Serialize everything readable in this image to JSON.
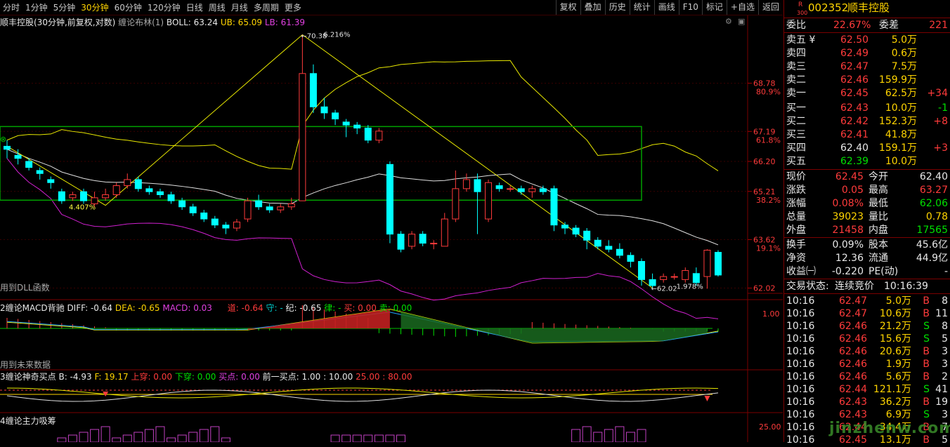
{
  "toolbar": {
    "timeframes": [
      "分时",
      "1分钟",
      "5分钟",
      "30分钟",
      "60分钟",
      "120分钟",
      "日线",
      "周线",
      "月线",
      "多周期",
      "更多"
    ],
    "active": "30分钟",
    "buttons": [
      "复权",
      "叠加",
      "历史",
      "统计",
      "画线",
      "F10",
      "标记",
      "+自选",
      "返回"
    ]
  },
  "main_panel": {
    "title": "顺丰控股(30分钟,前复权,对数)",
    "indicator": "缠论布林(1)",
    "boll_label": "BOLL: 63.24",
    "ub_label": "UB: 65.09",
    "lb_label": "LB: 61.39",
    "dll_text": "用到DLL函数",
    "high_mark": "70.38",
    "high_pct": "6.216%",
    "low_pct_left": "4.407%",
    "low_mark": "62.02",
    "low_pct_right": "1.978%",
    "circle_marker": "⊗"
  },
  "y_axis": [
    {
      "price": "68.78",
      "pct": "80.9%"
    },
    {
      "price": "67.19",
      "pct": "61.8%"
    },
    {
      "price": "66.20",
      "pct": ""
    },
    {
      "price": "65.21",
      "pct": "38.2%"
    },
    {
      "price": "63.62",
      "pct": "19.1%"
    },
    {
      "price": "62.02",
      "pct": ""
    }
  ],
  "macd_panel": {
    "name": "2缠论MACD背驰",
    "diff": "DIFF: -0.64",
    "dea": "DEA: -0.65",
    "macd": "MACD: 0.03",
    "dao": "道: -0.64",
    "shou": "守: -",
    "ji": "纪: -0.65",
    "lv": "律: -",
    "mai": "买: 0.00",
    "mai2": "卖: 0.00",
    "future_text": "用到未来数据",
    "axis": "1.00"
  },
  "buy_panel": {
    "name": "3缠论神奇买点",
    "b": "B: -4.93",
    "f": "F: 19.17",
    "shangchuan": "上穿: 0.00",
    "xiachuan": "下穿: 0.00",
    "maidian": "买点: 0.00",
    "prev": "前一买点: 1.00 : 10.00",
    "v25": "25.00 : 80.00"
  },
  "accum_panel": {
    "name": "4缠论主力吸筹",
    "axis": "25.00"
  },
  "quote": {
    "code": "002352",
    "name": "顺丰控股",
    "r_badge": "R",
    "sub_badge": "300",
    "weibi_label": "委比",
    "weibi": "22.67%",
    "weicha_label": "委差",
    "weicha": "221",
    "asks": [
      {
        "label": "卖五 ¥",
        "price": "62.50",
        "vol": "5.0万",
        "chg": ""
      },
      {
        "label": "卖四",
        "price": "62.49",
        "vol": "0.6万",
        "chg": ""
      },
      {
        "label": "卖三",
        "price": "62.47",
        "vol": "7.5万",
        "chg": ""
      },
      {
        "label": "卖二",
        "price": "62.46",
        "vol": "159.9万",
        "chg": ""
      },
      {
        "label": "卖一",
        "price": "62.45",
        "vol": "62.5万",
        "chg": "+34"
      }
    ],
    "bids": [
      {
        "label": "买一",
        "price": "62.43",
        "vol": "10.0万",
        "chg": "-1"
      },
      {
        "label": "买二",
        "price": "62.42",
        "vol": "152.3万",
        "chg": "+8"
      },
      {
        "label": "买三",
        "price": "62.41",
        "vol": "41.8万",
        "chg": ""
      },
      {
        "label": "买四",
        "price": "62.40",
        "vol": "159.1万",
        "chg": "+3"
      },
      {
        "label": "买五",
        "price": "62.39",
        "vol": "10.0万",
        "chg": ""
      }
    ],
    "stats": [
      [
        "现价",
        "62.45",
        "今开",
        "62.40"
      ],
      [
        "涨跌",
        "0.05",
        "最高",
        "63.27"
      ],
      [
        "涨幅",
        "0.08%",
        "最低",
        "62.06"
      ],
      [
        "总量",
        "39023",
        "量比",
        "0.78"
      ],
      [
        "外盘",
        "21458",
        "内盘",
        "17565"
      ]
    ],
    "stats2": [
      [
        "换手",
        "0.09%",
        "股本",
        "45.6亿"
      ],
      [
        "净资",
        "12.36",
        "流通",
        "44.9亿"
      ],
      [
        "收益㈠",
        "-0.220",
        "PE(动)",
        "-"
      ]
    ],
    "trade_state_label": "交易状态:",
    "trade_state": "连续竞价",
    "trade_time": "10:16:39",
    "ticks": [
      [
        "10:16",
        "62.47",
        "5.0万",
        "B",
        "8"
      ],
      [
        "10:16",
        "62.47",
        "10.6万",
        "B",
        "11"
      ],
      [
        "10:16",
        "62.46",
        "21.2万",
        "S",
        "8"
      ],
      [
        "10:16",
        "62.46",
        "15.6万",
        "S",
        "5"
      ],
      [
        "10:16",
        "62.46",
        "20.6万",
        "B",
        "3"
      ],
      [
        "10:16",
        "62.46",
        "1.9万",
        "B",
        "3"
      ],
      [
        "10:16",
        "62.46",
        "5.6万",
        "B",
        "2"
      ],
      [
        "10:16",
        "62.44",
        "121.1万",
        "S",
        "41"
      ],
      [
        "10:16",
        "62.43",
        "36.2万",
        "B",
        "19"
      ],
      [
        "10:16",
        "62.43",
        "6.9万",
        "S",
        "3"
      ],
      [
        "10:16",
        "62.44",
        "34.4万",
        "B",
        "7"
      ],
      [
        "10:16",
        "62.45",
        "13.1万",
        "B",
        "5"
      ]
    ]
  },
  "watermark": "jinzhenw.com",
  "colors": {
    "up": "#ff3b3b",
    "down": "#00ffff",
    "boll_mid": "#e0e0e0",
    "boll_up": "#e8e800",
    "boll_low": "#d020d0",
    "box": "#00a000"
  },
  "chart_data": {
    "type": "candlestick",
    "note_series": "30-minute candles, prices read from axis",
    "candles": [
      [
        66.7,
        66.6,
        66.9,
        66.3
      ],
      [
        66.4,
        66.3,
        66.6,
        66.1
      ],
      [
        66.2,
        66.0,
        66.3,
        65.9
      ],
      [
        65.9,
        65.8,
        66.0,
        65.6
      ],
      [
        65.6,
        65.5,
        65.7,
        65.3
      ],
      [
        65.2,
        64.9,
        65.3,
        64.8
      ],
      [
        65.0,
        65.1,
        65.2,
        64.9
      ],
      [
        65.2,
        64.9,
        65.3,
        64.8
      ],
      [
        64.8,
        65.0,
        65.2,
        64.7
      ],
      [
        65.0,
        65.1,
        65.3,
        64.9
      ],
      [
        65.1,
        65.4,
        65.5,
        65.0
      ],
      [
        65.4,
        65.6,
        65.8,
        65.3
      ],
      [
        65.6,
        65.3,
        65.7,
        65.2
      ],
      [
        65.3,
        65.2,
        65.4,
        65.1
      ],
      [
        65.2,
        65.1,
        65.3,
        65.0
      ],
      [
        65.1,
        64.9,
        65.2,
        64.8
      ],
      [
        64.9,
        64.7,
        65.0,
        64.6
      ],
      [
        64.7,
        64.5,
        64.8,
        64.4
      ],
      [
        64.5,
        64.3,
        64.6,
        64.2
      ],
      [
        64.3,
        64.1,
        64.4,
        64.0
      ],
      [
        64.1,
        64.0,
        64.2,
        63.8
      ],
      [
        64.0,
        64.2,
        64.3,
        63.9
      ],
      [
        64.3,
        64.9,
        65.0,
        64.2
      ],
      [
        64.9,
        64.7,
        65.1,
        64.6
      ],
      [
        64.7,
        64.6,
        64.8,
        64.5
      ],
      [
        64.6,
        64.7,
        64.8,
        64.5
      ],
      [
        64.7,
        64.8,
        65.0,
        64.6
      ],
      [
        64.9,
        69.1,
        70.38,
        64.9
      ],
      [
        69.1,
        68.0,
        69.4,
        67.8
      ],
      [
        68.0,
        67.8,
        68.3,
        67.6
      ],
      [
        67.8,
        67.6,
        67.9,
        67.4
      ],
      [
        67.5,
        67.4,
        67.6,
        67.0
      ],
      [
        67.4,
        67.3,
        67.5,
        67.1
      ],
      [
        67.3,
        66.9,
        67.4,
        66.8
      ],
      [
        66.9,
        67.2,
        67.3,
        66.8
      ],
      [
        66.1,
        63.8,
        66.2,
        63.5
      ],
      [
        63.8,
        63.3,
        63.9,
        63.2
      ],
      [
        63.4,
        63.8,
        63.9,
        63.3
      ],
      [
        63.8,
        63.5,
        63.9,
        63.4
      ],
      [
        63.5,
        63.5,
        63.6,
        63.3
      ],
      [
        63.4,
        64.3,
        64.5,
        63.4
      ],
      [
        64.3,
        65.3,
        65.9,
        64.2
      ],
      [
        65.3,
        65.6,
        65.8,
        65.2
      ],
      [
        65.6,
        65.2,
        65.8,
        63.8
      ],
      [
        64.3,
        65.5,
        65.6,
        64.2
      ],
      [
        65.4,
        65.3,
        65.5,
        65.2
      ],
      [
        65.3,
        65.3,
        65.4,
        65.2
      ],
      [
        65.3,
        65.2,
        65.4,
        65.1
      ],
      [
        65.2,
        65.3,
        65.4,
        65.0
      ],
      [
        65.3,
        65.2,
        65.4,
        65.1
      ],
      [
        65.3,
        64.1,
        65.4,
        63.9
      ],
      [
        64.1,
        64.0,
        64.2,
        63.8
      ],
      [
        64.0,
        63.8,
        64.1,
        63.7
      ],
      [
        63.9,
        63.6,
        64.0,
        63.3
      ],
      [
        63.6,
        63.4,
        63.7,
        63.3
      ],
      [
        63.4,
        63.3,
        63.6,
        63.2
      ],
      [
        63.3,
        63.1,
        63.5,
        63.0
      ],
      [
        63.1,
        62.9,
        63.2,
        62.7
      ],
      [
        62.9,
        62.3,
        63.0,
        62.1
      ],
      [
        62.3,
        62.1,
        62.5,
        62.02
      ],
      [
        62.3,
        62.4,
        62.5,
        62.2
      ],
      [
        62.4,
        62.4,
        62.5,
        62.3
      ],
      [
        62.3,
        62.6,
        62.7,
        62.2
      ],
      [
        62.5,
        62.2,
        62.7,
        62.1
      ],
      [
        62.4,
        63.27,
        63.3,
        62.0
      ],
      [
        63.2,
        62.45,
        63.27,
        62.4
      ]
    ]
  }
}
